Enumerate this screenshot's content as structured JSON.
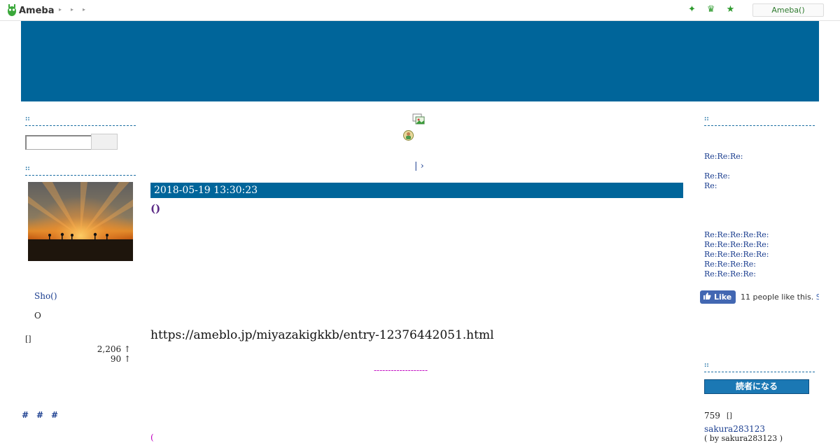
{
  "topbar": {
    "logo_text": "Ameba",
    "crumb_arrows": [
      "▸",
      "▸",
      "▸"
    ],
    "icons": [
      "sparkle-icon",
      "crown-icon",
      "star-icon"
    ],
    "account_button": "Ameba()"
  },
  "left_sidebar": {
    "search_heading": "::",
    "profile_heading": "::",
    "profile_name": "Sho()",
    "profile_sub": "O",
    "stats_label": "[]",
    "stats": [
      "2,206 ↑",
      "90 ↑"
    ],
    "hashtags": [
      "#",
      "#",
      "#"
    ]
  },
  "main": {
    "pager": "| ›",
    "date": "2018-05-19 13:30:23",
    "title": "()",
    "url_text": "https://ameblo.jp/miyazakigkkb/entry-12376442051.html",
    "divider": "-------------------",
    "bottom_text": "("
  },
  "right_sidebar": {
    "heading_top": "::",
    "comments_group_1": [
      "Re:Re:Re:",
      "Re:Re:",
      "Re:"
    ],
    "comments_group_2": [
      "Re:Re:Re:Re:Re:",
      "Re:Re:Re:Re:Re:",
      "Re:Re:Re:Re:Re:",
      "Re:Re:Re:Re:",
      "Re:Re:Re:Re:"
    ],
    "fb_like_label": "Like",
    "fb_count_text": "11 people like this.",
    "fb_signup": "S",
    "heading_reader": "::",
    "reader_button": "読者になる",
    "reader_count": "759",
    "reader_bracket": "[]",
    "reader_user": "sakura283123",
    "reader_by": "( by sakura283123 )"
  },
  "colors": {
    "brand_blue": "#00659a",
    "link": "#1a3d8f",
    "title_purple": "#5b2a86",
    "ameba_green": "#2d9a2d"
  }
}
